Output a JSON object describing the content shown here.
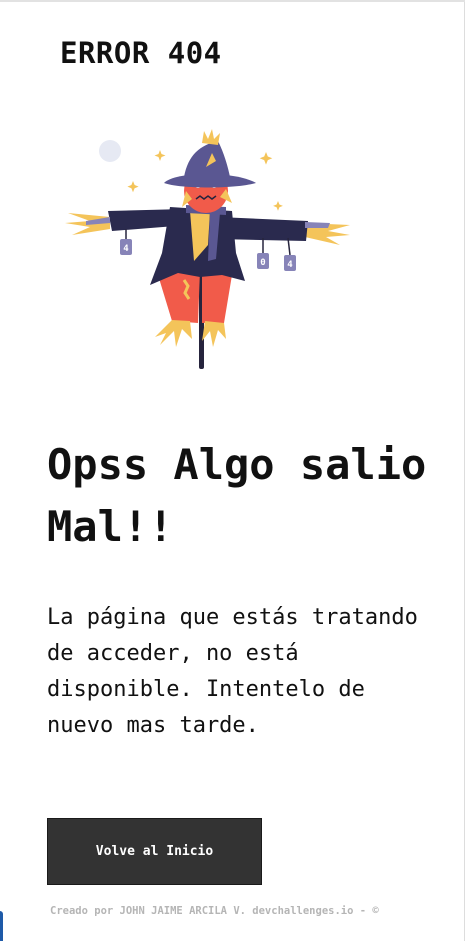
{
  "header": {
    "title": "ERROR 404"
  },
  "illustration": {
    "icon": "scarecrow-illustration",
    "tags": [
      "4",
      "0",
      "4"
    ],
    "colors": {
      "hat": "#5a5792",
      "coat": "#2a2a4e",
      "face": "#f15b4a",
      "pants": "#f15b4a",
      "straw": "#f4c45a",
      "scarf": "#5a5792",
      "moon": "#e6e9f3",
      "pole": "#26243d"
    }
  },
  "main": {
    "headline": "Opss Algo salio Mal!!",
    "message": "La página que estás tratando de acceder, no está disponible. Intentelo de nuevo mas tarde.",
    "button_label": "Volve al Inicio"
  },
  "footer": {
    "credit": "Creado por JOHN JAIME ARCILA V. devchallenges.io - ©"
  },
  "theme": {
    "button_bg": "#333333",
    "footer_text": "#b5b5b5",
    "text": "#111111"
  }
}
